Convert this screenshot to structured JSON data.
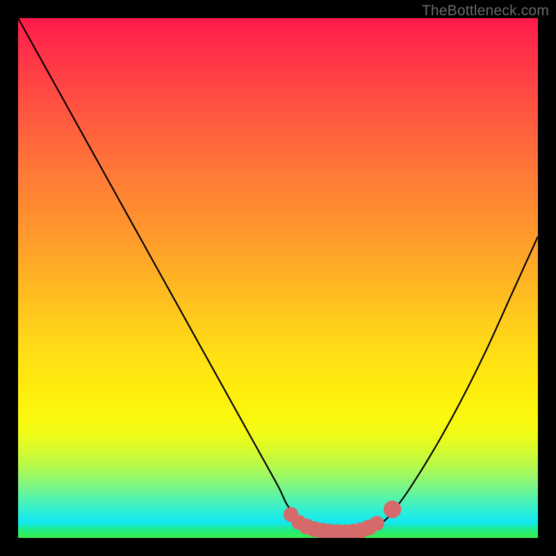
{
  "watermark": "TheBottleneck.com",
  "colors": {
    "background": "#000000",
    "curve_stroke": "#000000",
    "marker_fill": "#d66a6a",
    "marker_stroke": "#cf5a5a"
  },
  "chart_data": {
    "type": "line",
    "title": "",
    "xlabel": "",
    "ylabel": "",
    "xlim": [
      0,
      100
    ],
    "ylim": [
      0,
      100
    ],
    "grid": false,
    "legend": false,
    "series": [
      {
        "name": "bottleneck-curve",
        "x": [
          0,
          5,
          10,
          15,
          20,
          25,
          30,
          35,
          40,
          45,
          50,
          52,
          55,
          57,
          59,
          61,
          63,
          65,
          67,
          70,
          72,
          75,
          80,
          85,
          90,
          95,
          100
        ],
        "values": [
          100,
          91,
          82,
          73,
          64,
          55,
          46,
          37,
          28,
          19,
          10,
          6,
          3,
          2,
          1,
          1,
          1,
          1,
          2,
          3,
          5,
          9,
          17,
          26,
          36,
          47,
          58
        ]
      }
    ],
    "markers": [
      {
        "x": 52.5,
        "y": 4.5,
        "r": 1.0
      },
      {
        "x": 54.0,
        "y": 3.0,
        "r": 1.0
      },
      {
        "x": 55.5,
        "y": 2.2,
        "r": 1.1
      },
      {
        "x": 57.0,
        "y": 1.7,
        "r": 1.1
      },
      {
        "x": 58.5,
        "y": 1.4,
        "r": 1.1
      },
      {
        "x": 60.0,
        "y": 1.2,
        "r": 1.1
      },
      {
        "x": 61.5,
        "y": 1.1,
        "r": 1.1
      },
      {
        "x": 63.0,
        "y": 1.1,
        "r": 1.1
      },
      {
        "x": 64.5,
        "y": 1.2,
        "r": 1.1
      },
      {
        "x": 66.0,
        "y": 1.5,
        "r": 1.1
      },
      {
        "x": 67.5,
        "y": 2.0,
        "r": 1.1
      },
      {
        "x": 69.0,
        "y": 2.8,
        "r": 1.0
      },
      {
        "x": 72.0,
        "y": 5.5,
        "r": 1.3
      }
    ]
  }
}
